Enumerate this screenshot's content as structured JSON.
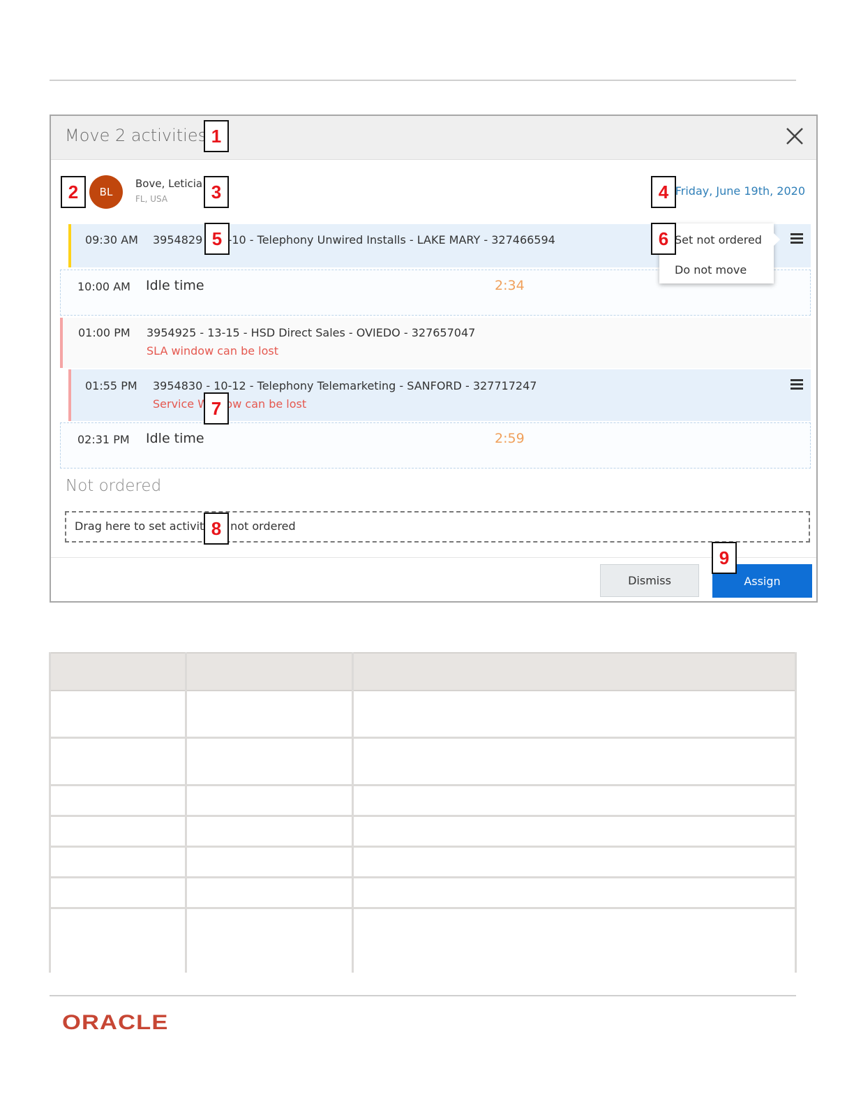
{
  "dialog": {
    "title": "Move 2 activities",
    "resource": {
      "initials": "BL",
      "name": "Bove, Leticia",
      "location": "FL, USA",
      "date": "Friday, June 19th, 2020"
    },
    "activities": [
      {
        "time": "09:30 AM",
        "title": "3954829 - 10-10 - Telephony Unwired Installs - LAKE MARY - 327466594"
      },
      {
        "time": "10:00 AM",
        "label": "Idle time",
        "duration": "2:34"
      },
      {
        "time": "01:00 PM",
        "title": "3954925 - 13-15 - HSD Direct Sales - OVIEDO - 327657047",
        "warning": "SLA window can be lost"
      },
      {
        "time": "01:55 PM",
        "title": "3954830 - 10-12 - Telephony Telemarketing - SANFORD - 327717247",
        "warning": "Service Window can be lost"
      },
      {
        "time": "02:31 PM",
        "label": "Idle time",
        "duration": "2:59"
      }
    ],
    "context_menu": {
      "items": [
        "Set not ordered",
        "Do not move"
      ]
    },
    "not_ordered": {
      "heading": "Not ordered",
      "drop_text": "Drag here to set activity as not ordered"
    },
    "buttons": {
      "dismiss": "Dismiss",
      "assign": "Assign"
    }
  },
  "callouts": [
    "1",
    "2",
    "3",
    "4",
    "5",
    "6",
    "7",
    "8",
    "9"
  ],
  "footer": {
    "logo": "ORACLE"
  },
  "colors": {
    "primary_button": "#0f6fd6",
    "avatar": "#c0460d",
    "warning_text": "#e5584f",
    "idle_duration": "#f0a05b",
    "date_link": "#2f7fb8",
    "oracle_red": "#c74634"
  }
}
